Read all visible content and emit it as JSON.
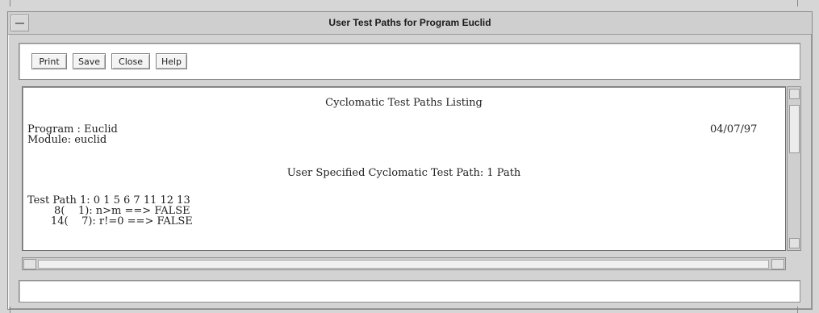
{
  "window": {
    "title": "User Test Paths for Program Euclid"
  },
  "toolbar": {
    "print_label": "Print",
    "save_label": "Save",
    "close_label": "Close",
    "help_label": "Help"
  },
  "listing": {
    "heading": "Cyclomatic Test Paths Listing",
    "program_line": "Program : Euclid",
    "module_line": "Module: euclid",
    "date": "04/07/97",
    "subheading": "User Specified Cyclomatic Test Path: 1 Path",
    "path_line": "Test Path 1: 0 1 5 6 7 11 12 13",
    "conditions": [
      "        8(    1): n>m ==> FALSE",
      "       14(    7): r!=0 ==> FALSE"
    ]
  },
  "status": {
    "text": ""
  }
}
